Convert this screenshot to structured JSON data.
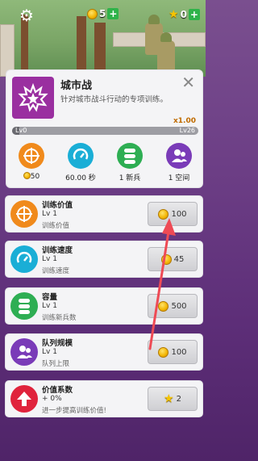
{
  "hud": {
    "coins": "5",
    "stars": "0"
  },
  "header": {
    "title": "城市战",
    "subtitle": "针对城市战斗行动的专项训练。",
    "multiplier": "x1.00",
    "level_min": "Lv0",
    "level_max": "Lv26",
    "level_progress": 0.04
  },
  "stats": [
    {
      "icon": "target-icon",
      "value": "50",
      "color": "#f08a1c"
    },
    {
      "icon": "timer-icon",
      "value": "60.00 秒",
      "color": "#1aaed6"
    },
    {
      "icon": "stack-icon",
      "value": "1 新兵",
      "color": "#2eae53"
    },
    {
      "icon": "users-icon",
      "value": "1 空间",
      "color": "#7a3bb8"
    }
  ],
  "upgrades": [
    {
      "name": "训练价值",
      "level": "Lv 1",
      "desc": "训练价值",
      "cost": "100",
      "currency": "coin",
      "icon": "target-icon",
      "color": "#f08a1c"
    },
    {
      "name": "训练速度",
      "level": "Lv 1",
      "desc": "训练速度",
      "cost": "45",
      "currency": "coin",
      "icon": "timer-icon",
      "color": "#1aaed6"
    },
    {
      "name": "容量",
      "level": "Lv 1",
      "desc": "训练新兵数",
      "cost": "500",
      "currency": "coin",
      "icon": "stack-icon",
      "color": "#2eae53"
    },
    {
      "name": "队列规模",
      "level": "Lv 1",
      "desc": "队列上限",
      "cost": "100",
      "currency": "coin",
      "icon": "users-icon",
      "color": "#7a3bb8"
    },
    {
      "name": "价值系数",
      "level": "+ 0%",
      "desc": "进一步提高训练价值!",
      "cost": "2",
      "currency": "star",
      "icon": "up-arrow-icon",
      "color": "#e0233c"
    }
  ],
  "colors": {
    "accent_arrow": "#ee4a55",
    "header_emblem": "#9a2fa0"
  }
}
